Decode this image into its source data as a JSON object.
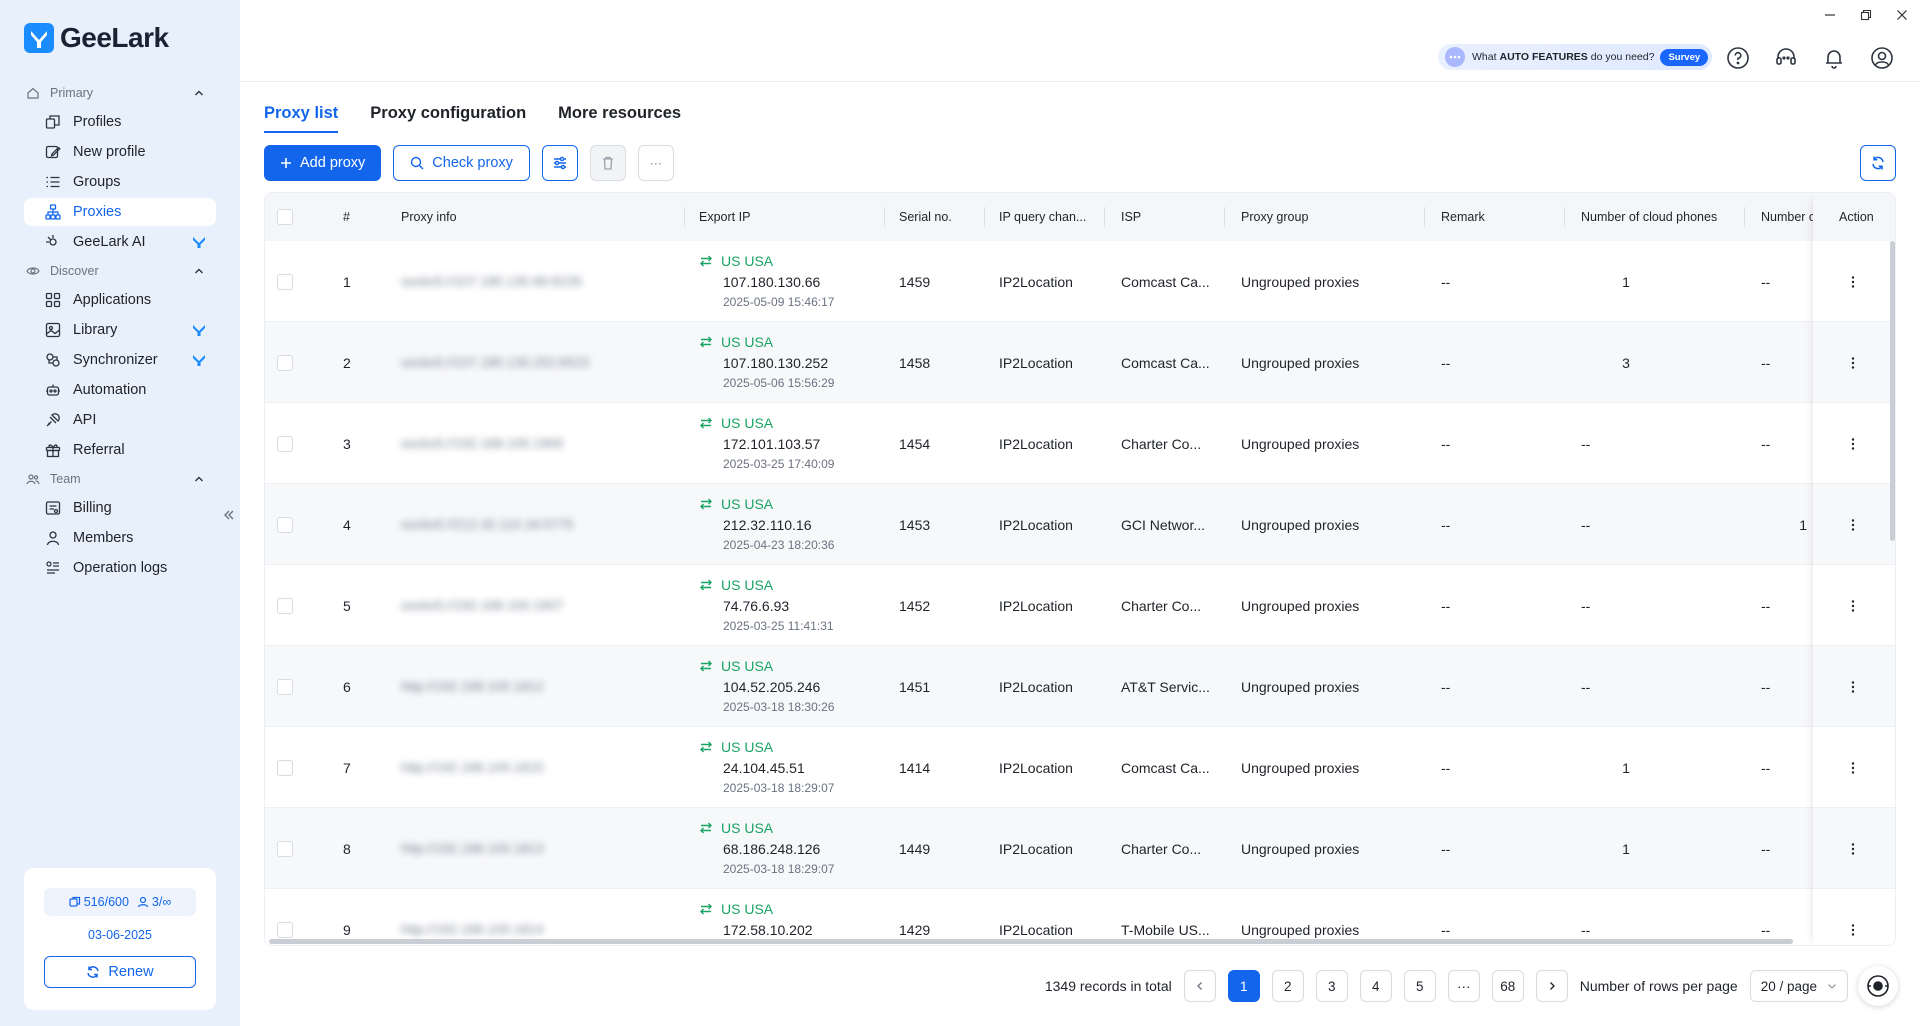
{
  "app": {
    "logo_text": "GeeLark"
  },
  "colors": {
    "accent": "#1366ec",
    "sidebar_bg": "#e8f0fb",
    "green": "#19a463"
  },
  "sidebar": {
    "sections": [
      {
        "label": "Primary",
        "icon": "home-icon",
        "items": [
          {
            "label": "Profiles",
            "icon": "profiles-icon"
          },
          {
            "label": "New profile",
            "icon": "edit-icon"
          },
          {
            "label": "Groups",
            "icon": "list-icon"
          },
          {
            "label": "Proxies",
            "icon": "network-icon",
            "active": true
          },
          {
            "label": "GeeLark AI",
            "icon": "ai-icon",
            "badge": "geelark-tick-icon"
          }
        ]
      },
      {
        "label": "Discover",
        "icon": "eye-icon",
        "items": [
          {
            "label": "Applications",
            "icon": "apps-icon"
          },
          {
            "label": "Library",
            "icon": "library-icon",
            "badge": "geelark-tick-icon"
          },
          {
            "label": "Synchronizer",
            "icon": "sync-icon",
            "badge": "geelark-tick-icon"
          },
          {
            "label": "Automation",
            "icon": "robot-icon"
          },
          {
            "label": "API",
            "icon": "api-icon"
          },
          {
            "label": "Referral",
            "icon": "gift-icon"
          }
        ]
      },
      {
        "label": "Team",
        "icon": "team-icon",
        "items": [
          {
            "label": "Billing",
            "icon": "billing-icon"
          },
          {
            "label": "Members",
            "icon": "user-icon"
          },
          {
            "label": "Operation logs",
            "icon": "logs-icon"
          }
        ]
      }
    ],
    "subscription": {
      "profiles": "516/600",
      "members": "3/∞",
      "date": "03-06-2025",
      "renew_label": "Renew"
    }
  },
  "topbar": {
    "survey": {
      "pre": "What",
      "highlight": "AUTO FEATURES",
      "post": "do you need?",
      "badge": "Survey"
    }
  },
  "tabs": [
    {
      "label": "Proxy list",
      "active": true
    },
    {
      "label": "Proxy configuration"
    },
    {
      "label": "More resources"
    }
  ],
  "toolbar": {
    "add_label": "Add proxy",
    "check_label": "Check proxy",
    "more_label": "···"
  },
  "table": {
    "columns": [
      "#",
      "Proxy info",
      "Export IP",
      "Serial no.",
      "IP query chan...",
      "ISP",
      "Proxy group",
      "Remark",
      "Number of cloud phones",
      "Number o",
      "Action"
    ],
    "rows": [
      {
        "num": "1",
        "proxy": "socks5://107.180.130.66:6235",
        "country": "US USA",
        "ip": "107.180.130.66",
        "time": "2025-05-09 15:46:17",
        "serial": "1459",
        "channel": "IP2Location",
        "isp": "Comcast Ca...",
        "group": "Ungrouped proxies",
        "remark": "--",
        "phones": "1",
        "numo": "--"
      },
      {
        "num": "2",
        "proxy": "socks5://107.180.130.252:6523",
        "country": "US USA",
        "ip": "107.180.130.252",
        "time": "2025-05-06 15:56:29",
        "serial": "1458",
        "channel": "IP2Location",
        "isp": "Comcast Ca...",
        "group": "Ungrouped proxies",
        "remark": "--",
        "phones": "3",
        "numo": "--"
      },
      {
        "num": "3",
        "proxy": "socks5://192.168.100.1900",
        "country": "US USA",
        "ip": "172.101.103.57",
        "time": "2025-03-25 17:40:09",
        "serial": "1454",
        "channel": "IP2Location",
        "isp": "Charter Co...",
        "group": "Ungrouped proxies",
        "remark": "--",
        "phones": "--",
        "numo": "--"
      },
      {
        "num": "4",
        "proxy": "socks5://212.32.110.16:5775",
        "country": "US USA",
        "ip": "212.32.110.16",
        "time": "2025-04-23 18:20:36",
        "serial": "1453",
        "channel": "IP2Location",
        "isp": "GCI Networ...",
        "group": "Ungrouped proxies",
        "remark": "--",
        "phones": "--",
        "numo": "1"
      },
      {
        "num": "5",
        "proxy": "socks5://192.168.100.1907",
        "country": "US USA",
        "ip": "74.76.6.93",
        "time": "2025-03-25 11:41:31",
        "serial": "1452",
        "channel": "IP2Location",
        "isp": "Charter Co...",
        "group": "Ungrouped proxies",
        "remark": "--",
        "phones": "--",
        "numo": "--"
      },
      {
        "num": "6",
        "proxy": "http://192.168.100.1812",
        "country": "US USA",
        "ip": "104.52.205.246",
        "time": "2025-03-18 18:30:26",
        "serial": "1451",
        "channel": "IP2Location",
        "isp": "AT&T Servic...",
        "group": "Ungrouped proxies",
        "remark": "--",
        "phones": "--",
        "numo": "--"
      },
      {
        "num": "7",
        "proxy": "http://192.168.100.1815",
        "country": "US USA",
        "ip": "24.104.45.51",
        "time": "2025-03-18 18:29:07",
        "serial": "1414",
        "channel": "IP2Location",
        "isp": "Comcast Ca...",
        "group": "Ungrouped proxies",
        "remark": "--",
        "phones": "1",
        "numo": "--"
      },
      {
        "num": "8",
        "proxy": "http://192.168.100.1813",
        "country": "US USA",
        "ip": "68.186.248.126",
        "time": "2025-03-18 18:29:07",
        "serial": "1449",
        "channel": "IP2Location",
        "isp": "Charter Co...",
        "group": "Ungrouped proxies",
        "remark": "--",
        "phones": "1",
        "numo": "--"
      },
      {
        "num": "9",
        "proxy": "http://192.168.100.1814",
        "country": "US USA",
        "ip": "172.58.10.202",
        "time": "",
        "serial": "1429",
        "channel": "IP2Location",
        "isp": "T-Mobile US...",
        "group": "Ungrouped proxies",
        "remark": "--",
        "phones": "--",
        "numo": "--"
      }
    ]
  },
  "pagination": {
    "total_text": "1349 records in total",
    "pages": [
      "1",
      "2",
      "3",
      "4",
      "5",
      "···",
      "68"
    ],
    "current": "1",
    "rows_label": "Number of rows per page",
    "per_page": "20 / page"
  }
}
